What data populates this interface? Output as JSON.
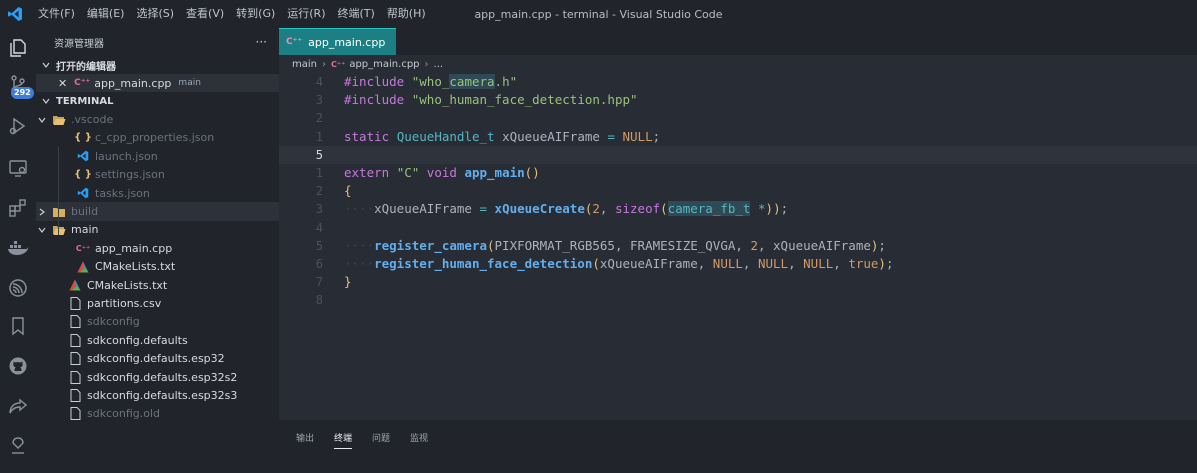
{
  "window": {
    "title": "app_main.cpp - terminal - Visual Studio Code",
    "menu": [
      "文件(F)",
      "编辑(E)",
      "选择(S)",
      "查看(V)",
      "转到(G)",
      "运行(R)",
      "终端(T)",
      "帮助(H)"
    ]
  },
  "activitybar": {
    "icons": [
      "explorer-icon",
      "source-control-icon",
      "run-debug-icon",
      "remote-explorer-icon",
      "extensions-icon",
      "docker-icon",
      "espressif-icon",
      "bookmarks-icon",
      "github-icon",
      "live-share-icon",
      "platformio-icon"
    ],
    "source_control_badge": "292"
  },
  "sidebar": {
    "title": "资源管理器",
    "more": "···",
    "open_editors_title": "打开的编辑器",
    "open_editor": {
      "close": "✕",
      "name": "app_main.cpp",
      "note": "main"
    },
    "workspace_title": "TERMINAL",
    "tree": [
      {
        "name": ".vscode",
        "type": "folder-open",
        "dim": true
      },
      {
        "name": "c_cpp_properties.json",
        "type": "json",
        "dim": true
      },
      {
        "name": "launch.json",
        "type": "vscode",
        "dim": true
      },
      {
        "name": "settings.json",
        "type": "json",
        "dim": true
      },
      {
        "name": "tasks.json",
        "type": "vscode",
        "dim": true
      },
      {
        "name": "build",
        "type": "folder-closed",
        "dim": true
      },
      {
        "name": "main",
        "type": "folder-open",
        "dim": false
      },
      {
        "name": "app_main.cpp",
        "type": "cpp",
        "dim": false
      },
      {
        "name": "CMakeLists.txt",
        "type": "cmake",
        "dim": false
      },
      {
        "name": "CMakeLists.txt",
        "type": "cmake",
        "dim": false
      },
      {
        "name": "partitions.csv",
        "type": "file",
        "dim": false
      },
      {
        "name": "sdkconfig",
        "type": "file",
        "dim": true
      },
      {
        "name": "sdkconfig.defaults",
        "type": "file",
        "dim": false
      },
      {
        "name": "sdkconfig.defaults.esp32",
        "type": "file",
        "dim": false
      },
      {
        "name": "sdkconfig.defaults.esp32s2",
        "type": "file",
        "dim": false
      },
      {
        "name": "sdkconfig.defaults.esp32s3",
        "type": "file",
        "dim": false
      },
      {
        "name": "sdkconfig.old",
        "type": "file",
        "dim": true
      }
    ]
  },
  "editor": {
    "tab_label": "app_main.cpp",
    "breadcrumb": [
      "main",
      "app_main.cpp",
      "..."
    ],
    "line_numbers": [
      "4",
      "3",
      "2",
      "1",
      "5",
      "1",
      "2",
      "3",
      "4",
      "5",
      "6",
      "7",
      "8"
    ],
    "current_line_index": 4,
    "code_lines": [
      "#include \"who_camera.h\"",
      "#include \"who_human_face_detection.hpp\"",
      "",
      "static QueueHandle_t xQueueAIFrame = NULL;",
      "",
      "extern \"C\" void app_main()",
      "{",
      "····xQueueAIFrame = xQueueCreate(2, sizeof(camera_fb_t *));",
      "",
      "····register_camera(PIXFORMAT_RGB565, FRAMESIZE_QVGA, 2, xQueueAIFrame);",
      "····register_human_face_detection(xQueueAIFrame, NULL, NULL, NULL, true);",
      "}",
      ""
    ]
  },
  "panel": {
    "tabs": [
      "输出",
      "终端",
      "问题",
      "监视"
    ],
    "active_tab": "终端"
  },
  "colors": {
    "tab_active": "#1c7f84",
    "badge": "#3f7ed8",
    "editor_bg": "#282c34",
    "sidebar_bg": "#21252b"
  }
}
